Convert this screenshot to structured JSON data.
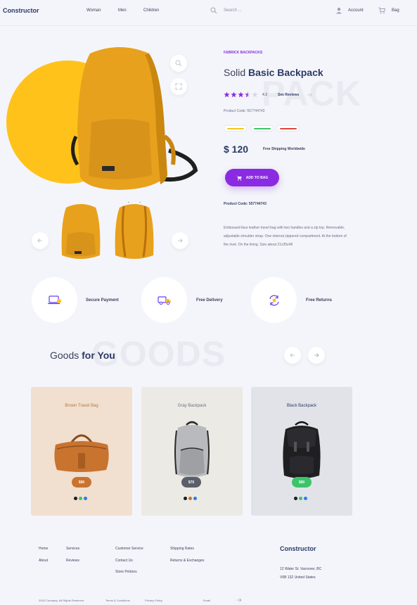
{
  "header": {
    "logo": "Constructor",
    "nav": [
      "Woman",
      "Men",
      "Children"
    ],
    "search_placeholder": "Search ...",
    "account_label": "Account",
    "bag_label": "Bag"
  },
  "product": {
    "category": "FABRICK BACKPACKS",
    "title_light": "Solid",
    "title_bold": "Basic Backpack",
    "watermark": "PACK",
    "rating": "4.3",
    "rating_value": 4.3,
    "rating_max": 5,
    "see_reviews": "See Reviews",
    "product_code": "Product Code: 557744743",
    "colors": [
      "#f5c518",
      "#3cc46a",
      "#e0453a"
    ],
    "price": "$ 120",
    "free_shipping": "Free Shipping Worldwide",
    "add_to_bag": "ADD TO BAG",
    "product_code_2": "Product Code: 557744743",
    "description": "Embossed faux leather travel bag with two handles and a zip top. Removable, adjustable shoulder strap. One internal zippered compartment. At the bottom of the rivet. On the lining. Size about 21x35x48"
  },
  "features": [
    {
      "label": "Secure Payment",
      "icon": "payment-icon"
    },
    {
      "label": "Free Delivery",
      "icon": "delivery-truck-icon"
    },
    {
      "label": "Free Returns",
      "icon": "returns-icon"
    }
  ],
  "goods": {
    "title_light": "Goods",
    "title_bold": "for You",
    "watermark": "GOODS",
    "cards": [
      {
        "title": "Brown Travel Bag",
        "price": "$90",
        "bg": "#f1dfd0",
        "title_color": "#b77a3f",
        "price_bg": "#c8732e",
        "dots": [
          "#1c1c1c",
          "#3cc46a",
          "#2f7be0"
        ]
      },
      {
        "title": "Gray Backpack",
        "price": "$70",
        "bg": "#eceae4",
        "title_color": "#6a6f88",
        "price_bg": "#5a5f6a",
        "dots": [
          "#1c1c1c",
          "#c8732e",
          "#2f7be0"
        ]
      },
      {
        "title": "Black Backpack",
        "price": "$90",
        "bg": "#e1e3e9",
        "title_color": "#2b3a67",
        "price_bg": "#3cc46a",
        "dots": [
          "#1c1c1c",
          "#3cc46a",
          "#2f7be0"
        ]
      }
    ]
  },
  "footer": {
    "col1": [
      "Home",
      "About"
    ],
    "col2": [
      "Services",
      "Reviews"
    ],
    "col3": [
      "Customer Service",
      "Contact Us",
      "Store Policies"
    ],
    "col4": [
      "Shipping Rates",
      "Returns & Exchanges"
    ],
    "brand": "Constructor",
    "address_1": "12 Water St. Vacnover, BC",
    "address_2": "V6B 132 United States",
    "copyright": "2020 Comapny. All Rights Reserved.",
    "terms": "Terms & Conditions",
    "privacy": "Privacy Policy",
    "email_label": "Email"
  }
}
